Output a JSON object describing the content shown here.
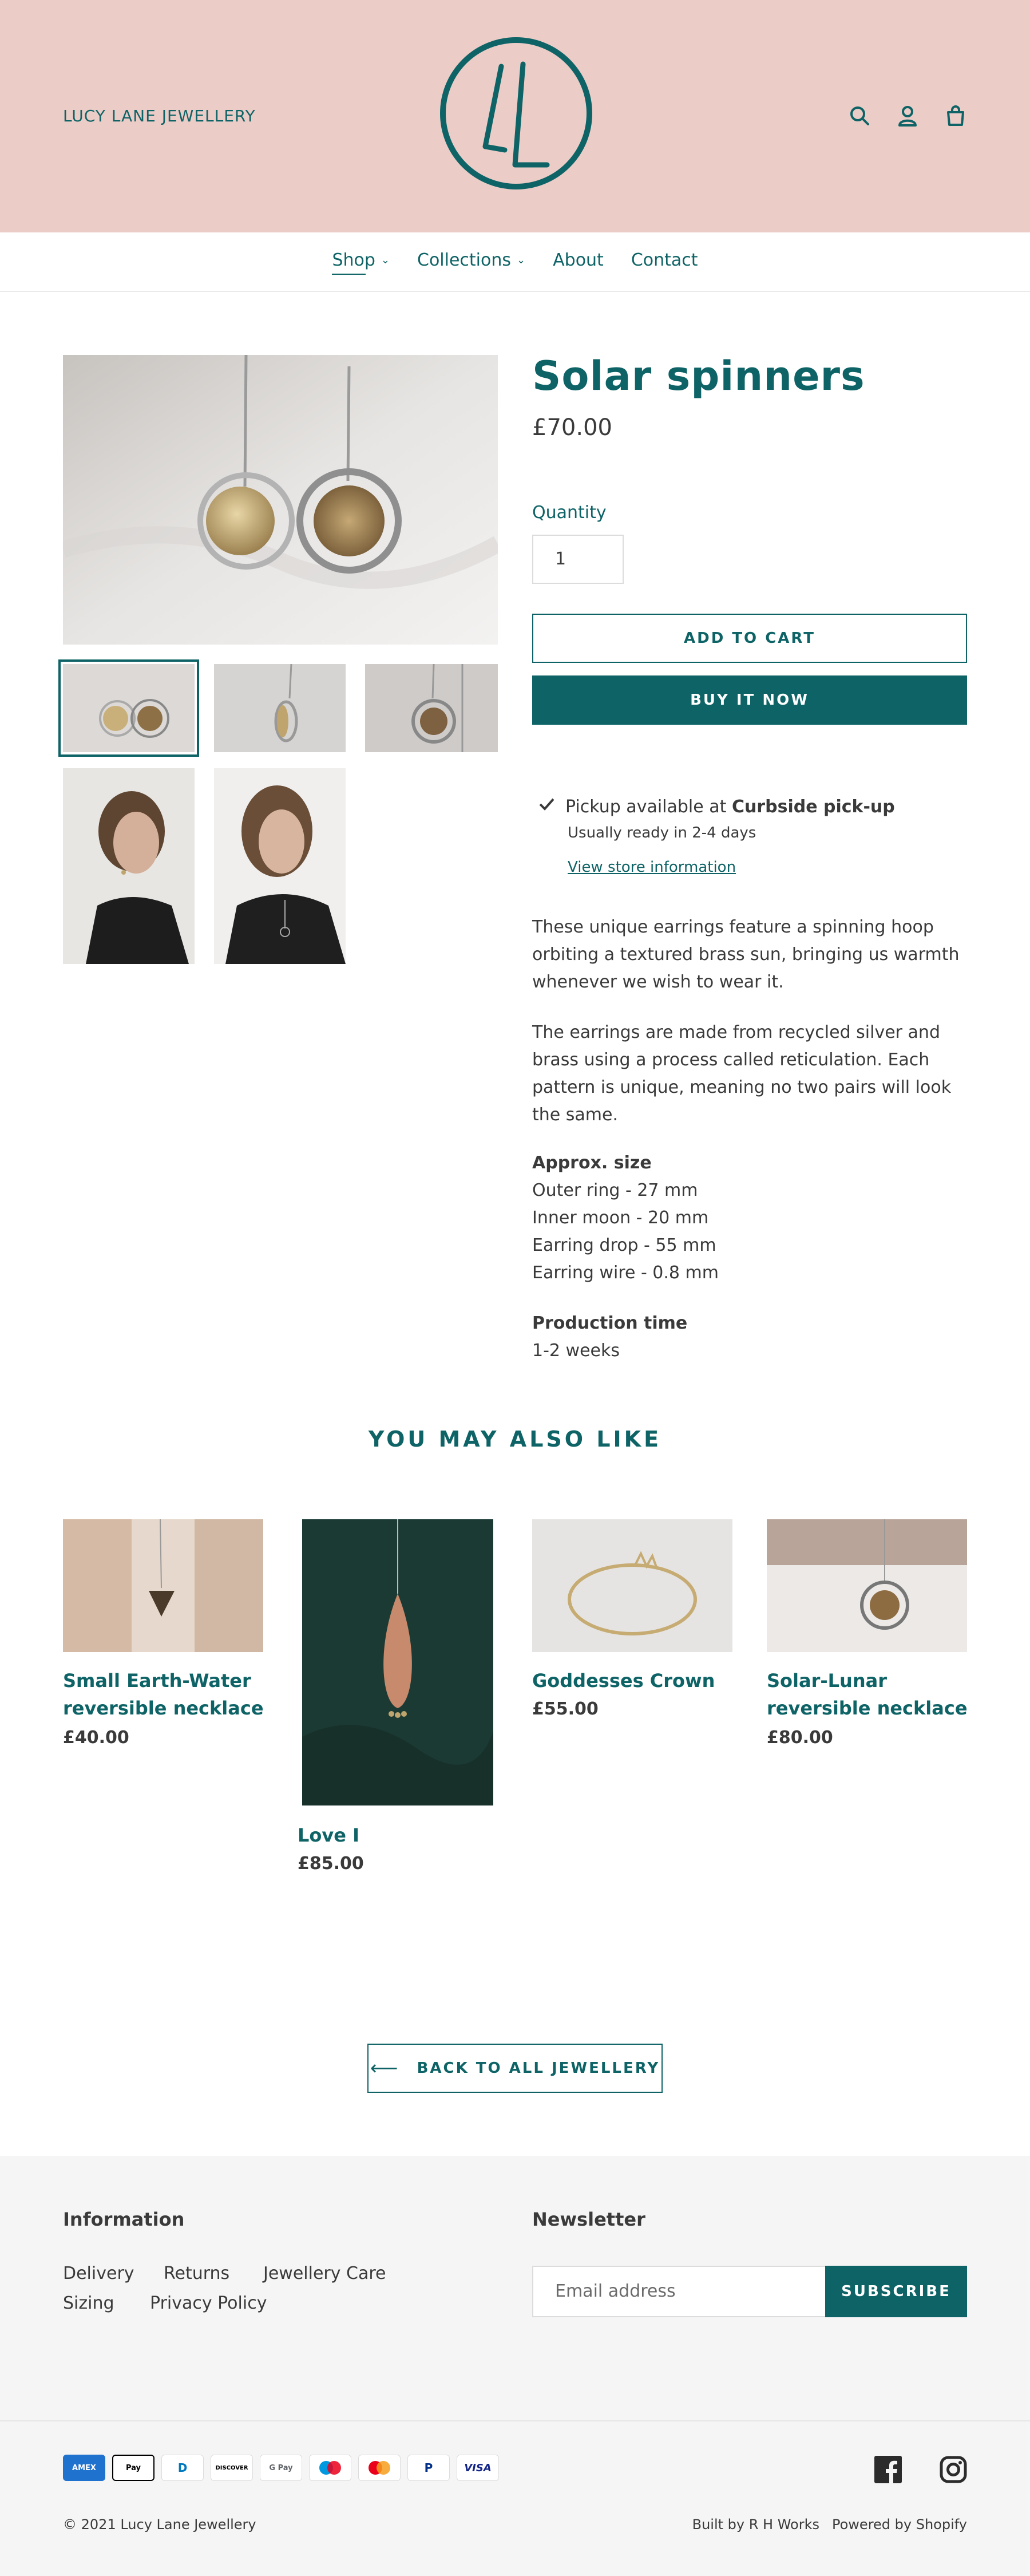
{
  "header": {
    "brand": "LUCY LANE JEWELLERY",
    "logo_icon": "lucy-lane-logo",
    "icons": [
      "search-icon",
      "account-icon",
      "cart-icon"
    ]
  },
  "nav": {
    "items": [
      {
        "label": "Shop",
        "has_dropdown": true,
        "active": true
      },
      {
        "label": "Collections",
        "has_dropdown": true,
        "active": false
      },
      {
        "label": "About",
        "has_dropdown": false,
        "active": false
      },
      {
        "label": "Contact",
        "has_dropdown": false,
        "active": false
      }
    ]
  },
  "product": {
    "title": "Solar spinners",
    "price": "£70.00",
    "quantity_label": "Quantity",
    "quantity_value": "1",
    "add_to_cart": "ADD TO CART",
    "buy_now": "BUY IT NOW",
    "pickup": {
      "prefix": "Pickup available at ",
      "location": "Curbside pick-up",
      "ready": "Usually ready in 2-4 days",
      "link": "View store information"
    },
    "description": [
      "These unique earrings feature a spinning hoop orbiting a textured brass sun, bringing us warmth whenever we wish to wear it.",
      "The earrings are made from recycled silver and brass using a process called reticulation. Each pattern is unique, meaning no two pairs will look the same."
    ],
    "size": {
      "heading": "Approx. size",
      "lines": [
        "Outer ring - 27 mm",
        "Inner moon - 20 mm",
        "Earring drop - 55 mm",
        "Earring wire - 0.8 mm"
      ]
    },
    "production": {
      "heading": "Production time",
      "value": "1-2 weeks"
    }
  },
  "recommendations": {
    "title": "YOU MAY ALSO LIKE",
    "items": [
      {
        "name_line1": "Small Earth-Water",
        "name_line2": "reversible necklace",
        "price": "£40.00"
      },
      {
        "name_line1": "Love I",
        "name_line2": "",
        "price": "£85.00"
      },
      {
        "name_line1": "Goddesses Crown",
        "name_line2": "",
        "price": "£55.00"
      },
      {
        "name_line1": "Solar-Lunar",
        "name_line2": "reversible necklace",
        "price": "£80.00"
      }
    ]
  },
  "back_button": "BACK TO ALL JEWELLERY",
  "footer": {
    "info_heading": "Information",
    "links": [
      "Delivery",
      "Returns",
      "Jewellery Care",
      "Sizing",
      "Privacy Policy"
    ],
    "newsletter_heading": "Newsletter",
    "email_placeholder": "Email address",
    "subscribe": "SUBSCRIBE",
    "payments": [
      "AMEX",
      "Pay",
      "D",
      "DISCOVER",
      "G Pay",
      "maestro",
      "mastercard",
      "P",
      "VISA"
    ],
    "social_icons": [
      "facebook-icon",
      "instagram-icon"
    ],
    "copyright": "© 2021 Lucy Lane Jewellery",
    "built_by": "Built by R H Works",
    "powered_by": "Powered by Shopify"
  },
  "colors": {
    "accent": "#0e6366",
    "header_bg": "#ecccc7",
    "footer_bg": "#f5f5f5",
    "text": "#3a3a3a"
  }
}
